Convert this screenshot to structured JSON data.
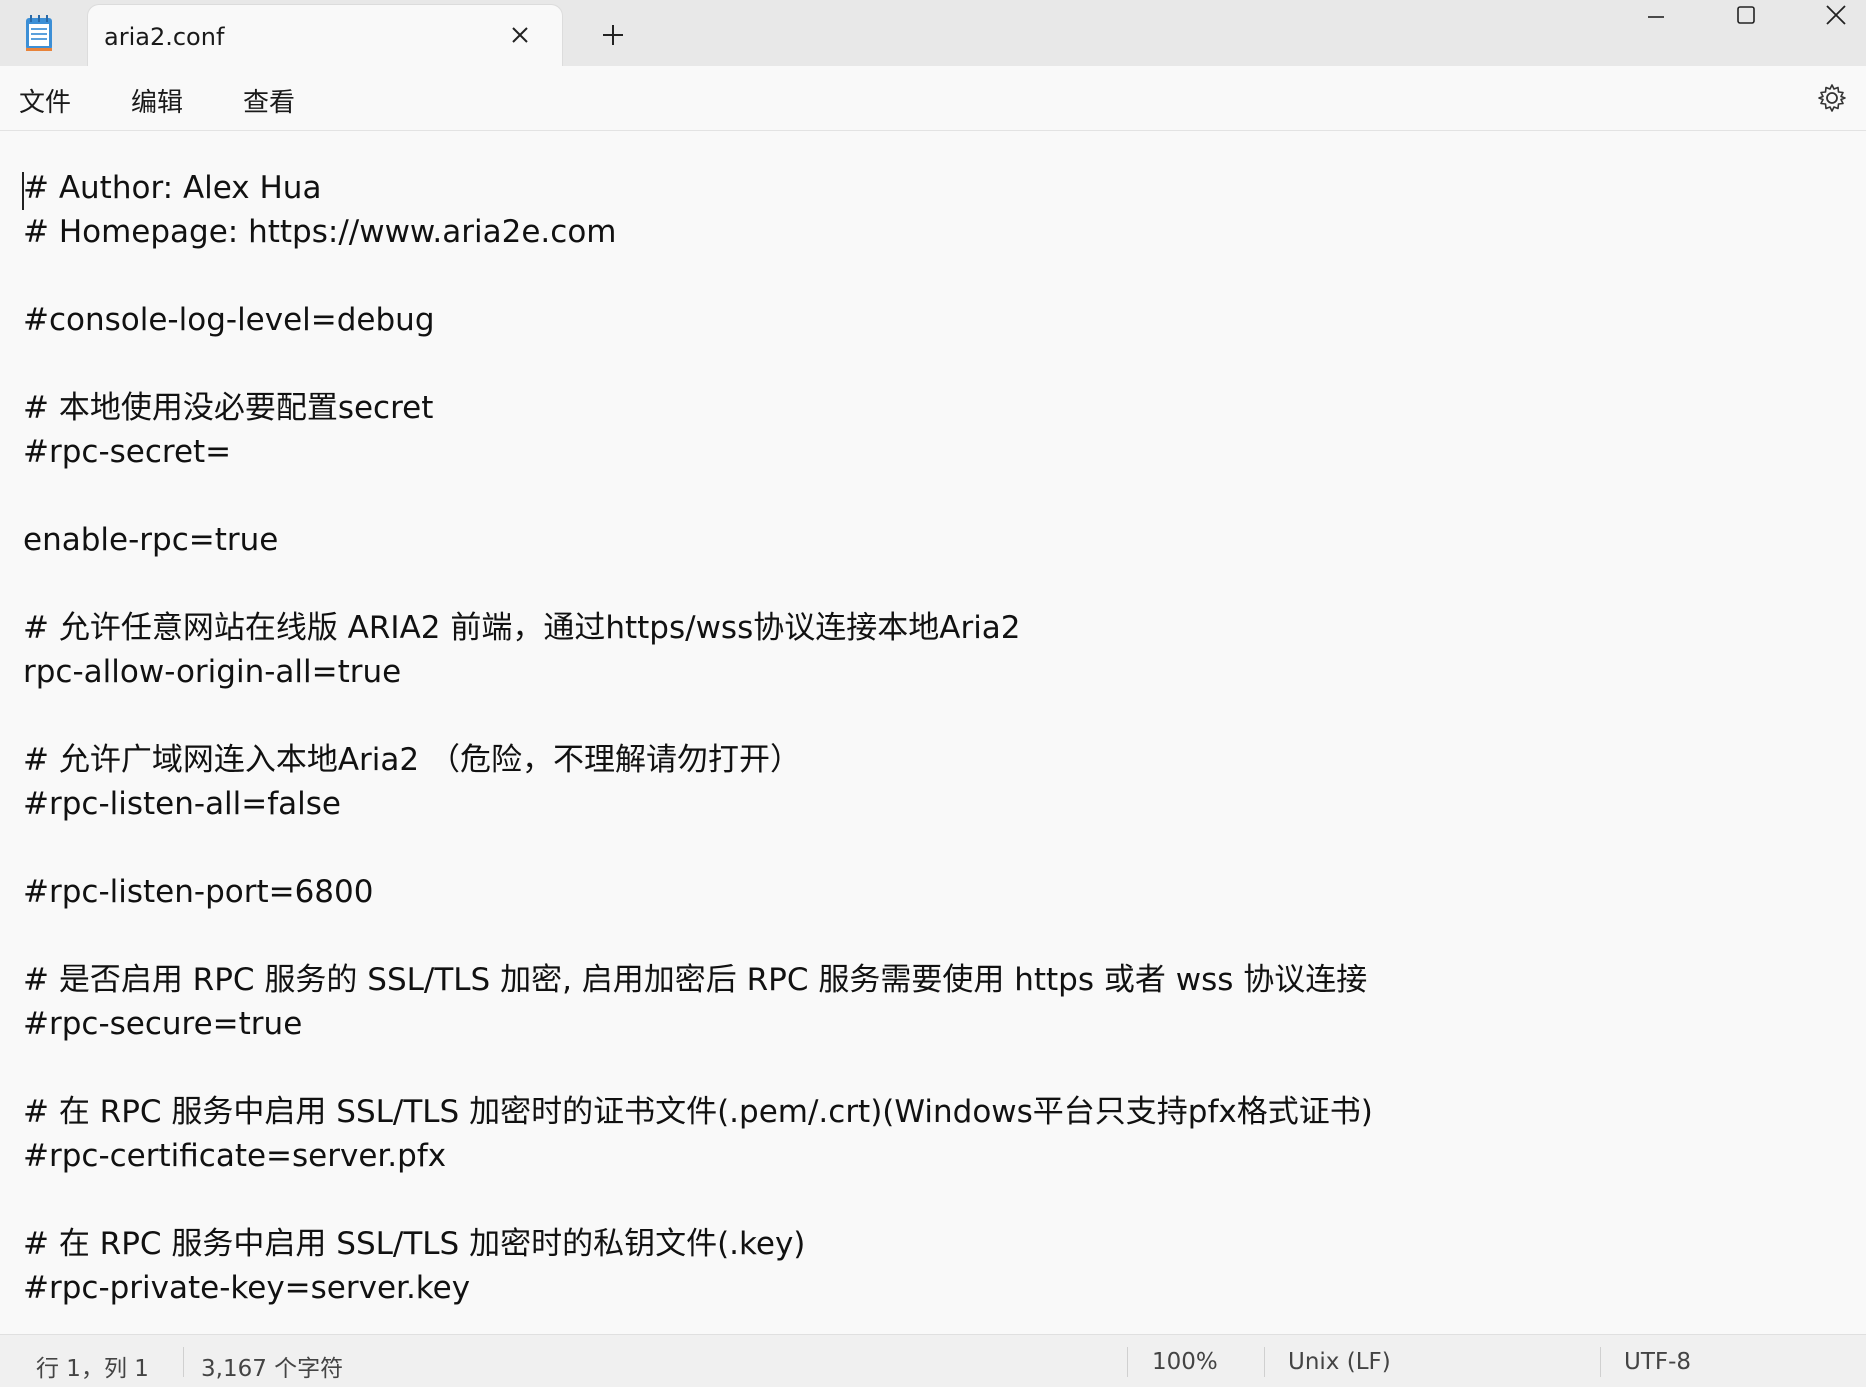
{
  "tab": {
    "title": "aria2.conf"
  },
  "menu": {
    "file": "文件",
    "edit": "编辑",
    "view": "查看"
  },
  "editor": {
    "lines": [
      "# Author: Alex Hua",
      "# Homepage: https://www.aria2e.com",
      "",
      "#console-log-level=debug",
      "",
      "# 本地使用没必要配置secret",
      "#rpc-secret=",
      "",
      "enable-rpc=true",
      "",
      "# 允许任意网站在线版 ARIA2 前端，通过https/wss协议连接本地Aria2",
      "rpc-allow-origin-all=true",
      "",
      "# 允许广域网连入本地Aria2 （危险，不理解请勿打开）",
      "#rpc-listen-all=false",
      "",
      "#rpc-listen-port=6800",
      "",
      "# 是否启用 RPC 服务的 SSL/TLS 加密, 启用加密后 RPC 服务需要使用 https 或者 wss 协议连接",
      "#rpc-secure=true",
      "",
      "# 在 RPC 服务中启用 SSL/TLS 加密时的证书文件(.pem/.crt)(Windows平台只支持pfx格式证书)",
      "#rpc-certificate=server.pfx",
      "",
      "# 在 RPC 服务中启用 SSL/TLS 加密时的私钥文件(.key)",
      "#rpc-private-key=server.key"
    ]
  },
  "status": {
    "position": "行 1，列 1",
    "chars": "3,167 个字符",
    "zoom": "100%",
    "line_ending": "Unix (LF)",
    "encoding": "UTF-8"
  }
}
